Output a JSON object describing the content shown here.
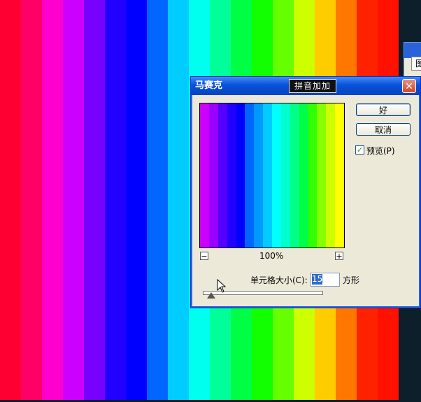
{
  "canvas": {
    "stripe_colors": [
      "#ff0033",
      "#ff0066",
      "#ff00cc",
      "#cc00ff",
      "#7700ff",
      "#2200ff",
      "#0000ff",
      "#0066ff",
      "#00ccff",
      "#00ffee",
      "#00ff99",
      "#00ff44",
      "#11ff00",
      "#66ff00",
      "#ccff00",
      "#ffcc00",
      "#ff7700",
      "#ff2200",
      "#ff1100"
    ]
  },
  "background_panel": {
    "visible_char": "图"
  },
  "dialog": {
    "title": "马赛克",
    "ime_indicator": "拼音加加",
    "close_glyph": "✕",
    "preview_colors": [
      "#cc00ff",
      "#9900ff",
      "#5500ff",
      "#2200ff",
      "#0000ff",
      "#0066ff",
      "#0099ff",
      "#00ccff",
      "#00ffff",
      "#00ffcc",
      "#00ff88",
      "#00ff44",
      "#33ff00",
      "#88ff00",
      "#ccff00",
      "#ffff00"
    ],
    "zoom_out_glyph": "−",
    "zoom_in_glyph": "+",
    "zoom_level": "100%",
    "ok_label": "好",
    "cancel_label": "取消",
    "preview_checked_glyph": "✓",
    "preview_label": "预览(P)",
    "cell_size_label": "单元格大小(C):",
    "cell_size_value": "15",
    "cell_size_unit": "方形",
    "icons": [
      "close-icon",
      "zoom-out-icon",
      "zoom-in-icon",
      "checkmark-icon",
      "slider-thumb-icon",
      "cursor-icon"
    ]
  }
}
